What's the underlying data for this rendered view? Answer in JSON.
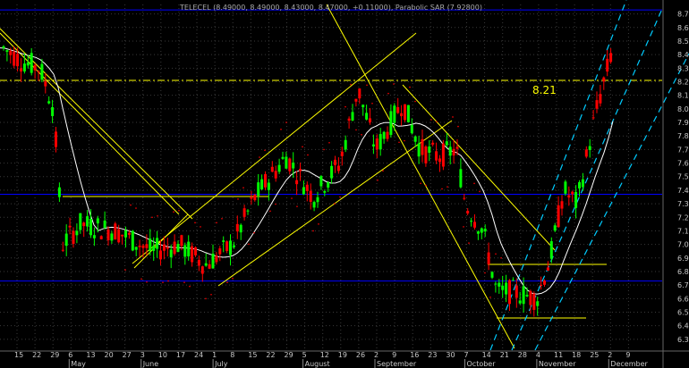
{
  "chart_data": {
    "type": "candlestick",
    "title": "TELECEL (8.49000, 8.49000, 8.43000, 8.47000, +0.11000), Parabolic SAR (7.92800)",
    "annotation": "8.21",
    "y_ticks": [
      "8.7",
      "8.6",
      "8.5",
      "8.4",
      "8.3",
      "8.2",
      "8.1",
      "8.0",
      "7.9",
      "7.8",
      "7.7",
      "7.6",
      "7.5",
      "7.4",
      "7.3",
      "7.2",
      "7.1",
      "7.0",
      "6.9",
      "6.8",
      "6.7",
      "6.6",
      "6.5",
      "6.4",
      "6.3"
    ],
    "ylim": [
      6.22,
      8.77
    ],
    "x_day_ticks": [
      "15",
      "22",
      "29",
      "6",
      "13",
      "20",
      "27",
      "3",
      "10",
      "17",
      "24",
      "1",
      "8",
      "15",
      "22",
      "29",
      "5",
      "12",
      "19",
      "26",
      "2",
      "9",
      "16",
      "23",
      "30",
      "7",
      "14",
      "21",
      "28",
      "4",
      "11",
      "18",
      "25",
      "2",
      "9"
    ],
    "x_month_labels": [
      "May",
      "June",
      "July",
      "August",
      "September",
      "October",
      "November",
      "December"
    ],
    "grid": true,
    "colors": {
      "up": "#00ff00",
      "down": "#ff0000",
      "moving_average": "#ffffff",
      "trendlines": "#ffff00",
      "horizontal_levels": "#0000ff",
      "channel": "#00ccff",
      "sar": "#ff0000",
      "grid": "#3a3a3a",
      "axis_text": "#c8c8c8"
    },
    "horizontal_levels": [
      8.73,
      7.37,
      6.73
    ],
    "reference_level": 8.21
  }
}
